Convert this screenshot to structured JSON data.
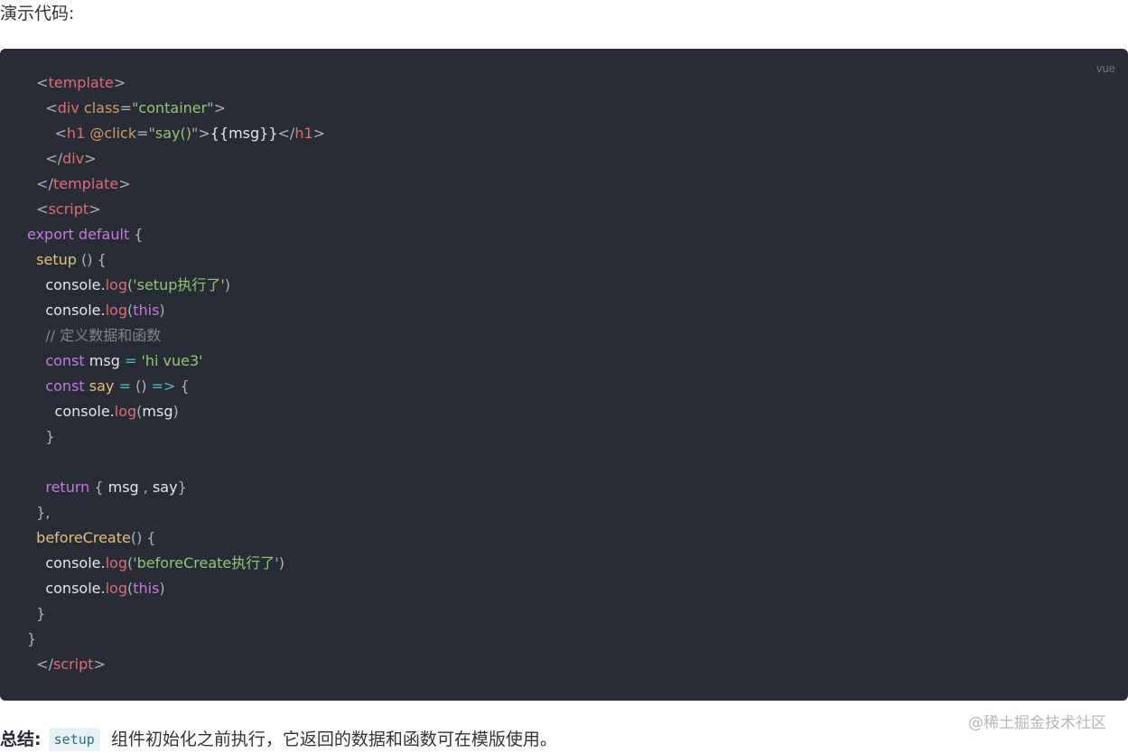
{
  "intro_text": "演示代码:",
  "code_block": {
    "language": "vue",
    "lines": [
      [
        [
          "  ",
          "punct"
        ],
        [
          "<",
          "punct"
        ],
        [
          "template",
          "tag"
        ],
        [
          ">",
          "punct"
        ]
      ],
      [
        [
          "    ",
          "punct"
        ],
        [
          "<",
          "punct"
        ],
        [
          "div",
          "tag"
        ],
        [
          " ",
          "punct"
        ],
        [
          "class",
          "attr"
        ],
        [
          "=",
          "punct"
        ],
        [
          "\"",
          "punct"
        ],
        [
          "container",
          "str"
        ],
        [
          "\"",
          "punct"
        ],
        [
          ">",
          "punct"
        ]
      ],
      [
        [
          "      ",
          "punct"
        ],
        [
          "<",
          "punct"
        ],
        [
          "h1",
          "tag"
        ],
        [
          " ",
          "punct"
        ],
        [
          "@click",
          "attr"
        ],
        [
          "=",
          "punct"
        ],
        [
          "\"",
          "punct"
        ],
        [
          "say()",
          "str"
        ],
        [
          "\"",
          "punct"
        ],
        [
          ">",
          "punct"
        ],
        [
          "{{msg}}",
          "plain"
        ],
        [
          "</",
          "punct"
        ],
        [
          "h1",
          "tag"
        ],
        [
          ">",
          "punct"
        ]
      ],
      [
        [
          "    ",
          "punct"
        ],
        [
          "</",
          "punct"
        ],
        [
          "div",
          "tag"
        ],
        [
          ">",
          "punct"
        ]
      ],
      [
        [
          "  ",
          "punct"
        ],
        [
          "</",
          "punct"
        ],
        [
          "template",
          "tag"
        ],
        [
          ">",
          "punct"
        ]
      ],
      [
        [
          "  ",
          "punct"
        ],
        [
          "<",
          "punct"
        ],
        [
          "script",
          "tag"
        ],
        [
          ">",
          "punct"
        ]
      ],
      [
        [
          "export",
          "kw"
        ],
        [
          " ",
          "punct"
        ],
        [
          "default",
          "kw"
        ],
        [
          " {",
          "punct"
        ]
      ],
      [
        [
          "  ",
          "punct"
        ],
        [
          "setup",
          "method"
        ],
        [
          " () {",
          "punct"
        ]
      ],
      [
        [
          "    ",
          "punct"
        ],
        [
          "console",
          "plain"
        ],
        [
          ".",
          "plain"
        ],
        [
          "log",
          "tag"
        ],
        [
          "(",
          "punct"
        ],
        [
          "'setup执行了'",
          "str"
        ],
        [
          ")",
          "punct"
        ]
      ],
      [
        [
          "    ",
          "punct"
        ],
        [
          "console",
          "plain"
        ],
        [
          ".",
          "plain"
        ],
        [
          "log",
          "tag"
        ],
        [
          "(",
          "punct"
        ],
        [
          "this",
          "kw"
        ],
        [
          ")",
          "punct"
        ]
      ],
      [
        [
          "    ",
          "punct"
        ],
        [
          "// 定义数据和函数",
          "comment"
        ]
      ],
      [
        [
          "    ",
          "punct"
        ],
        [
          "const",
          "kw"
        ],
        [
          " msg ",
          "plain"
        ],
        [
          "=",
          "op"
        ],
        [
          " ",
          "punct"
        ],
        [
          "'hi vue3'",
          "str"
        ]
      ],
      [
        [
          "    ",
          "punct"
        ],
        [
          "const",
          "kw"
        ],
        [
          " ",
          "punct"
        ],
        [
          "say",
          "method"
        ],
        [
          " ",
          "punct"
        ],
        [
          "=",
          "op"
        ],
        [
          " () ",
          "punct"
        ],
        [
          "=>",
          "op"
        ],
        [
          " {",
          "punct"
        ]
      ],
      [
        [
          "      ",
          "punct"
        ],
        [
          "console",
          "plain"
        ],
        [
          ".",
          "plain"
        ],
        [
          "log",
          "tag"
        ],
        [
          "(",
          "punct"
        ],
        [
          "msg",
          "plain"
        ],
        [
          ")",
          "punct"
        ]
      ],
      [
        [
          "    ",
          "punct"
        ],
        [
          "}",
          "punct"
        ]
      ],
      [
        [
          "",
          "punct"
        ]
      ],
      [
        [
          "    ",
          "punct"
        ],
        [
          "return",
          "kw"
        ],
        [
          " { ",
          "punct"
        ],
        [
          "msg",
          "plain"
        ],
        [
          " , ",
          "punct"
        ],
        [
          "say",
          "plain"
        ],
        [
          "}",
          "punct"
        ]
      ],
      [
        [
          "  ",
          "punct"
        ],
        [
          "},",
          "punct"
        ]
      ],
      [
        [
          "  ",
          "punct"
        ],
        [
          "beforeCreate",
          "method"
        ],
        [
          "() {",
          "punct"
        ]
      ],
      [
        [
          "    ",
          "punct"
        ],
        [
          "console",
          "plain"
        ],
        [
          ".",
          "plain"
        ],
        [
          "log",
          "tag"
        ],
        [
          "(",
          "punct"
        ],
        [
          "'beforeCreate执行了'",
          "str"
        ],
        [
          ")",
          "punct"
        ]
      ],
      [
        [
          "    ",
          "punct"
        ],
        [
          "console",
          "plain"
        ],
        [
          ".",
          "plain"
        ],
        [
          "log",
          "tag"
        ],
        [
          "(",
          "punct"
        ],
        [
          "this",
          "kw"
        ],
        [
          ")",
          "punct"
        ]
      ],
      [
        [
          "  ",
          "punct"
        ],
        [
          "}",
          "punct"
        ]
      ],
      [
        [
          "}",
          "punct"
        ]
      ],
      [
        [
          "  ",
          "punct"
        ],
        [
          "</",
          "punct"
        ],
        [
          "script",
          "tag"
        ],
        [
          ">",
          "punct"
        ]
      ]
    ]
  },
  "watermark": "@稀土掘金技术社区",
  "summary": {
    "label": "总结:",
    "inline_code": "setup",
    "text": "组件初始化之前执行，它返回的数据和函数可在模版使用。"
  }
}
